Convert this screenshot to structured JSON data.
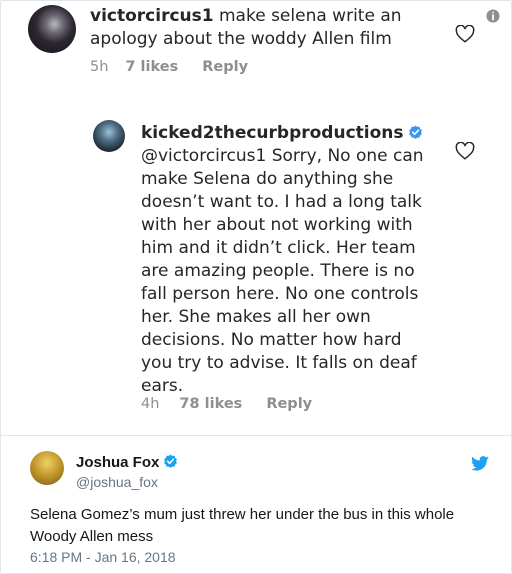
{
  "comment1": {
    "username": "victorcircus1",
    "text": "make selena write an apology about the woddy Allen film",
    "time": "5h",
    "likes": "7 likes",
    "reply_label": "Reply"
  },
  "comment2": {
    "username": "kicked2thecurbproductions",
    "mention": "@victorcircus1",
    "text": "Sorry, No one can make Selena do anything she doesn’t want to. I had a long talk with her about not working with him and it didn’t click. Her team are amazing people. There is no fall person here. No one controls her. She makes all her own decisions. No matter how hard you try to advise. It falls on deaf ears.",
    "time": "4h",
    "likes": "78 likes",
    "reply_label": "Reply"
  },
  "tweet": {
    "name": "Joshua Fox",
    "handle": "@joshua_fox",
    "text": "Selena Gomez’s mum just threw her under the bus in this whole Woody Allen mess",
    "timestamp": "6:18 PM - Jan 16, 2018"
  },
  "colors": {
    "verified_blue": "#3897f0",
    "twitter_blue": "#1da1f2",
    "meta_gray": "#8e8e8e"
  },
  "icons": [
    "heart-icon",
    "info-icon",
    "verified-badge-icon",
    "twitter-bird-icon"
  ]
}
